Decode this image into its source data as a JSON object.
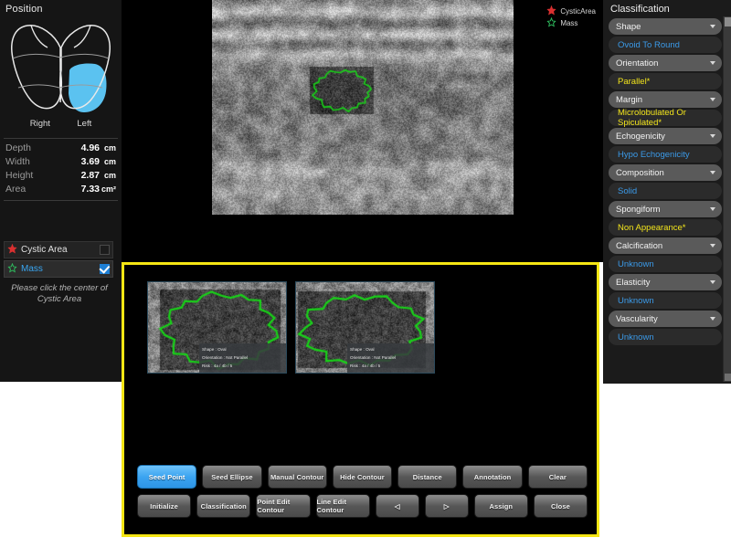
{
  "left_panel": {
    "position_title": "Position",
    "lobe_right_label": "Right",
    "lobe_left_label": "Left",
    "selected_lobe": "Left",
    "selected_lobe_color": "#5bc2f0",
    "measurements": [
      {
        "label": "Depth",
        "value": "4.96",
        "unit": "cm"
      },
      {
        "label": "Width",
        "value": "3.69",
        "unit": "cm"
      },
      {
        "label": "Height",
        "value": "2.87",
        "unit": "cm"
      },
      {
        "label": "Area",
        "value": "7.33",
        "unit": "cm²"
      }
    ],
    "layers": [
      {
        "name": "Cystic Area",
        "icon": "red-star-icon",
        "checked": false,
        "selected": false
      },
      {
        "name": "Mass",
        "icon": "green-star-icon",
        "checked": true,
        "selected": true
      }
    ],
    "hint": "Please click the center of Cystic Area"
  },
  "main_stage": {
    "legend": [
      {
        "label": "CysticArea",
        "icon": "red-star-icon",
        "color": "#d93030"
      },
      {
        "label": "Mass",
        "icon": "green-star-icon",
        "color": "#2fbf5f"
      }
    ]
  },
  "tool_panel": {
    "border_color": "#f5e614",
    "thumbnails": [
      {
        "name": "thumbnail-1",
        "overlay": [
          "Shape : Oval",
          "Orientation : Not Parallel",
          "Risk : 4a / 4b / 5"
        ]
      },
      {
        "name": "thumbnail-2",
        "overlay": [
          "Shape : Oval",
          "Orientation : Not Parallel",
          "Risk : 4a / 4b / 5"
        ]
      }
    ],
    "buttons_row1": [
      {
        "label": "Seed Point",
        "active": true,
        "narrow": false
      },
      {
        "label": "Seed Ellipse",
        "active": false,
        "narrow": false
      },
      {
        "label": "Manual Contour",
        "active": false,
        "narrow": false
      },
      {
        "label": "Hide Contour",
        "active": false,
        "narrow": false
      },
      {
        "label": "Distance",
        "active": false,
        "narrow": false
      },
      {
        "label": "Annotation",
        "active": false,
        "narrow": false
      },
      {
        "label": "Clear",
        "active": false,
        "narrow": false
      }
    ],
    "buttons_row2": [
      {
        "label": "Initialize",
        "active": false,
        "narrow": false
      },
      {
        "label": "Classification",
        "active": false,
        "narrow": false
      },
      {
        "label": "Point Edit Contour",
        "active": false,
        "narrow": false
      },
      {
        "label": "Line Edit Contour",
        "active": false,
        "narrow": false
      },
      {
        "label": "◁",
        "active": false,
        "narrow": true,
        "icon": "prev-arrow-icon"
      },
      {
        "label": "▷",
        "active": false,
        "narrow": true,
        "icon": "next-arrow-icon"
      },
      {
        "label": "Assign",
        "active": false,
        "narrow": false
      },
      {
        "label": "Close",
        "active": false,
        "narrow": false
      }
    ]
  },
  "right_panel": {
    "title": "Classification",
    "entries": [
      {
        "category": "Shape",
        "value": "Ovoid To Round",
        "value_color": "#3b9ae8"
      },
      {
        "category": "Orientation",
        "value": "Parallel*",
        "value_color": "#f2e41c"
      },
      {
        "category": "Margin",
        "value": "Microlobulated Or Spiculated*",
        "value_color": "#f2e41c"
      },
      {
        "category": "Echogenicity",
        "value": "Hypo Echogenicity",
        "value_color": "#3b9ae8"
      },
      {
        "category": "Composition",
        "value": "Solid",
        "value_color": "#3b9ae8"
      },
      {
        "category": "Spongiform",
        "value": "Non Appearance*",
        "value_color": "#f2e41c"
      },
      {
        "category": "Calcification",
        "value": "Unknown",
        "value_color": "#3b9ae8"
      },
      {
        "category": "Elasticity",
        "value": "Unknown",
        "value_color": "#3b9ae8"
      },
      {
        "category": "Vascularity",
        "value": "Unknown",
        "value_color": "#3b9ae8"
      }
    ]
  }
}
